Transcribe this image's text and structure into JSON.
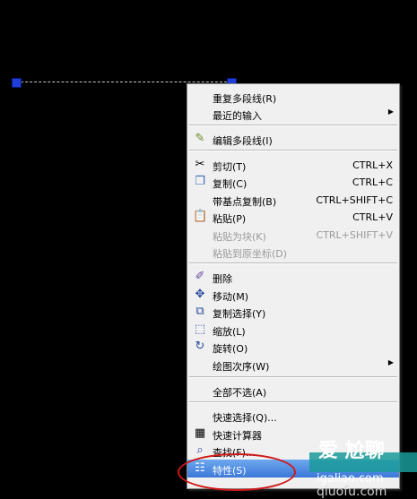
{
  "menu": {
    "repeat_polyline": "重复多段线(R)",
    "recent_input": "最近的输入",
    "edit_polyline": "编辑多段线(I)",
    "cut": {
      "label": "剪切(T)",
      "shortcut": "CTRL+X"
    },
    "copy": {
      "label": "复制(C)",
      "shortcut": "CTRL+C"
    },
    "copy_with_base": {
      "label": "带基点复制(B)",
      "shortcut": "CTRL+SHIFT+C"
    },
    "paste": {
      "label": "粘贴(P)",
      "shortcut": "CTRL+V"
    },
    "paste_as_block": {
      "label": "粘贴为块(K)",
      "shortcut": "CTRL+SHIFT+V"
    },
    "paste_orig_coords": {
      "label": "粘贴到原坐标(D)"
    },
    "erase": "删除",
    "move": "移动(M)",
    "copy_selection": "复制选择(Y)",
    "scale": "缩放(L)",
    "rotate": "旋转(O)",
    "draw_order": "绘图次序(W)",
    "deselect_all": "全部不选(A)",
    "quick_select": "快速选择(Q)...",
    "quick_calc": "快速计算器",
    "find": "查找(F)...",
    "properties": "特性(S)"
  },
  "watermark": {
    "brand": "爱 尬聊",
    "site": "igaliao.com",
    "bottom": "qiuofu.com"
  },
  "colors": {
    "highlight": "#3b78d8",
    "grip": "#1f3fd8",
    "annotation": "#d01818"
  }
}
